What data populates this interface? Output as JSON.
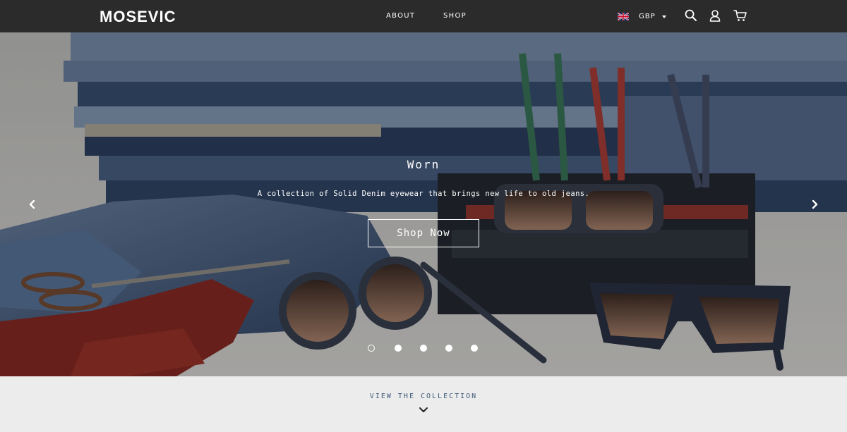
{
  "header": {
    "logo": "MOSEVIC",
    "nav": {
      "about": "ABOUT",
      "shop": "SHOP"
    },
    "currency": {
      "code": "GBP",
      "flag_icon": "uk-flag-icon"
    },
    "icons": [
      "search-icon",
      "account-icon",
      "cart-icon"
    ]
  },
  "hero": {
    "title": "Worn",
    "subtitle": "A collection of Solid Denim eyewear that brings new life to old jeans.",
    "cta": "Shop Now",
    "prev_icon": "chevron-left-icon",
    "next_icon": "chevron-right-icon",
    "slide_count": 5,
    "active_slide": 1
  },
  "collection": {
    "link": "VIEW THE COLLECTION",
    "icon": "chevron-down-icon"
  },
  "colors": {
    "header_bg": "#2b2b2b",
    "strip_bg": "#ececec",
    "collection_link": "#3e5a78"
  }
}
